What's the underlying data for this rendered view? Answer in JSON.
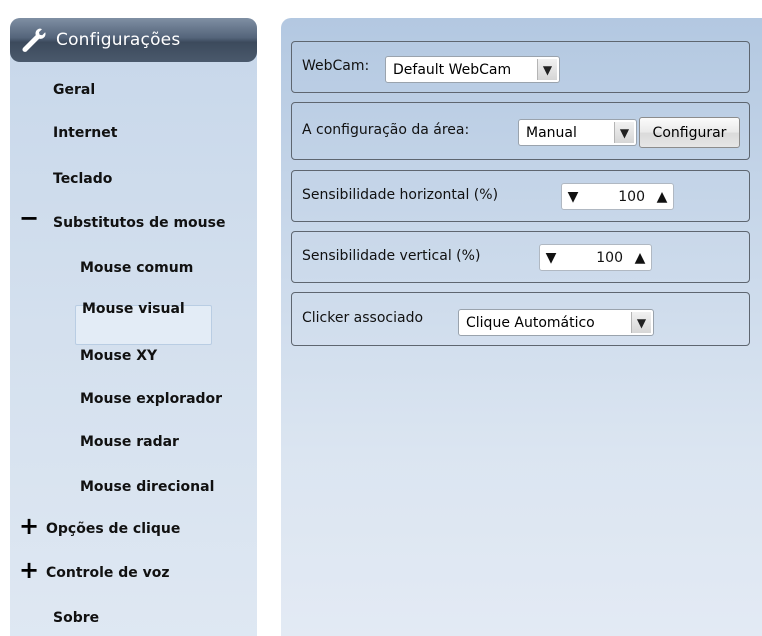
{
  "sidebar": {
    "title": "Configurações",
    "items": [
      {
        "label": "Geral"
      },
      {
        "label": "Internet"
      },
      {
        "label": "Teclado"
      },
      {
        "label": "Substitutos de mouse",
        "sign": "−"
      },
      {
        "label": "Mouse comum"
      },
      {
        "label": "Mouse visual",
        "selected": true
      },
      {
        "label": "Mouse XY"
      },
      {
        "label": "Mouse explorador"
      },
      {
        "label": "Mouse radar"
      },
      {
        "label": "Mouse direcional"
      },
      {
        "label": "Opções de clique",
        "sign": "+"
      },
      {
        "label": "Controle de voz",
        "sign": "+"
      },
      {
        "label": "Sobre"
      }
    ]
  },
  "main": {
    "webcam": {
      "label": "WebCam:",
      "value": "Default WebCam"
    },
    "area": {
      "label": "A configuração da área:",
      "value": "Manual",
      "button": "Configurar"
    },
    "horizontal": {
      "label": "Sensibilidade horizontal (%)",
      "value": "100"
    },
    "vertical": {
      "label": "Sensibilidade vertical (%)",
      "value": "100"
    },
    "clicker": {
      "label": "Clicker associado",
      "value": "Clique Automático"
    }
  },
  "glyphs": {
    "down": "▼",
    "up": "▲"
  }
}
